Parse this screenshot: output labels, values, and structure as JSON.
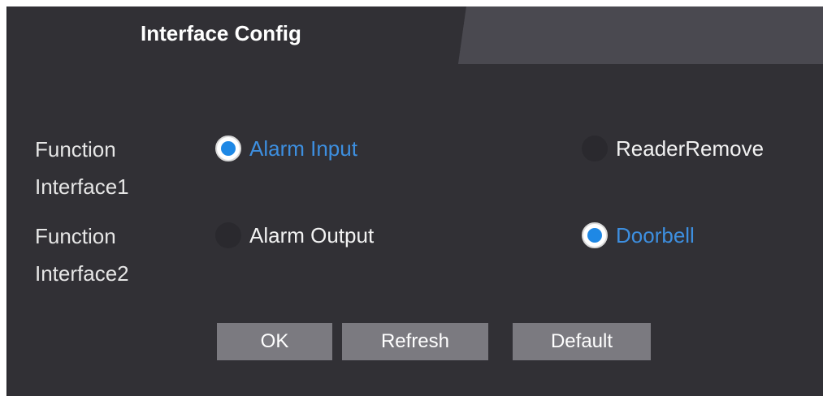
{
  "tab": {
    "title": "Interface Config"
  },
  "rows": [
    {
      "label_line1": "Function",
      "label_line2": "Interface1",
      "options": [
        {
          "label": "Alarm Input",
          "checked": true
        },
        {
          "label": "ReaderRemove",
          "checked": false
        }
      ]
    },
    {
      "label_line1": "Function",
      "label_line2": "Interface2",
      "options": [
        {
          "label": "Alarm Output",
          "checked": false
        },
        {
          "label": "Doorbell",
          "checked": true
        }
      ]
    }
  ],
  "buttons": {
    "ok": "OK",
    "refresh": "Refresh",
    "default": "Default"
  },
  "colors": {
    "panel_background": "#313035",
    "selected_text": "#3d8fe0",
    "radio_dot": "#1e88e5",
    "button_background": "#7b7a80"
  }
}
